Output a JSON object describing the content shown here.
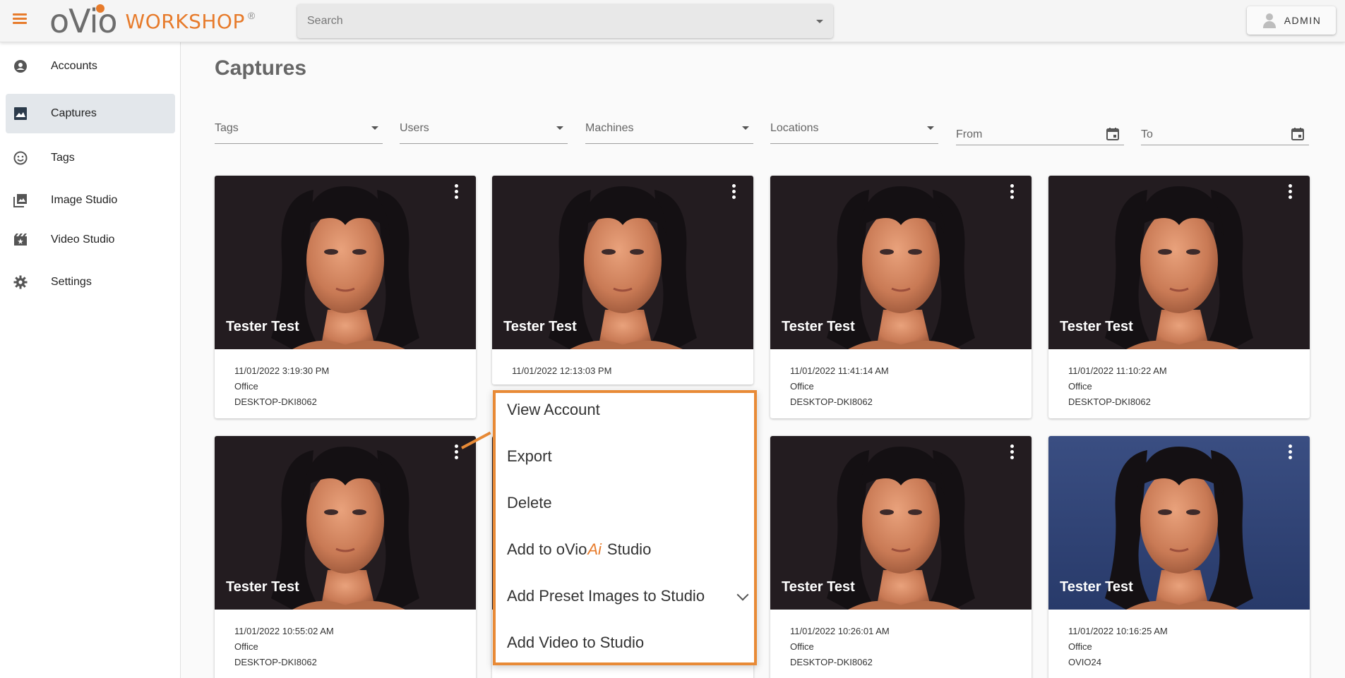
{
  "header": {
    "brand_mark": "oVio",
    "brand_text": "WORKSHOP",
    "brand_reg": "®",
    "search_placeholder": "Search",
    "user_label": "ADMIN",
    "accent_color": "#e77b2b"
  },
  "sidebar": {
    "items": [
      {
        "label": "Accounts",
        "icon": "account-circle-icon"
      },
      {
        "label": "Captures",
        "icon": "image-icon",
        "active": true
      },
      {
        "label": "Tags",
        "icon": "smiley-icon"
      },
      {
        "label": "Image Studio",
        "icon": "photo-library-icon"
      },
      {
        "label": "Video Studio",
        "icon": "movie-filter-icon"
      },
      {
        "label": "Settings",
        "icon": "gear-icon"
      }
    ]
  },
  "page": {
    "title": "Captures",
    "filters": [
      "Tags",
      "Users",
      "Machines",
      "Locations"
    ],
    "date_filters": [
      "From",
      "To"
    ]
  },
  "cards": [
    {
      "name": "Tester Test",
      "datetime": "11/01/2022 3:19:30 PM",
      "location": "Office",
      "machine": "DESKTOP-DKI8062",
      "background": "dark"
    },
    {
      "name": "Tester Test",
      "datetime": "11/01/2022 12:13:03 PM",
      "location": "",
      "machine": "",
      "background": "dark"
    },
    {
      "name": "Tester Test",
      "datetime": "11/01/2022 11:41:14 AM",
      "location": "Office",
      "machine": "DESKTOP-DKI8062",
      "background": "dark"
    },
    {
      "name": "Tester Test",
      "datetime": "11/01/2022 11:10:22 AM",
      "location": "Office",
      "machine": "DESKTOP-DKI8062",
      "background": "dark"
    },
    {
      "name": "Tester Test",
      "datetime": "11/01/2022 10:55:02 AM",
      "location": "Office",
      "machine": "DESKTOP-DKI8062",
      "background": "dark"
    },
    {
      "name": "",
      "datetime": "",
      "location": "",
      "machine": "",
      "background": "dark"
    },
    {
      "name": "Tester Test",
      "datetime": "11/01/2022 10:26:01 AM",
      "location": "Office",
      "machine": "DESKTOP-DKI8062",
      "background": "dark"
    },
    {
      "name": "Tester Test",
      "datetime": "11/01/2022 10:16:25 AM",
      "location": "Office",
      "machine": "OVIO24",
      "background": "blue"
    }
  ],
  "context_menu": {
    "items": [
      {
        "label": "View Account"
      },
      {
        "label": "Export"
      },
      {
        "label": "Delete"
      },
      {
        "label_prefix": "Add to oVio",
        "label_ai": "Ai",
        "label_suffix": "Studio"
      },
      {
        "label": "Add Preset Images to Studio",
        "has_submenu": true
      },
      {
        "label": "Add Video to Studio"
      }
    ],
    "border_color": "#e88a36"
  }
}
